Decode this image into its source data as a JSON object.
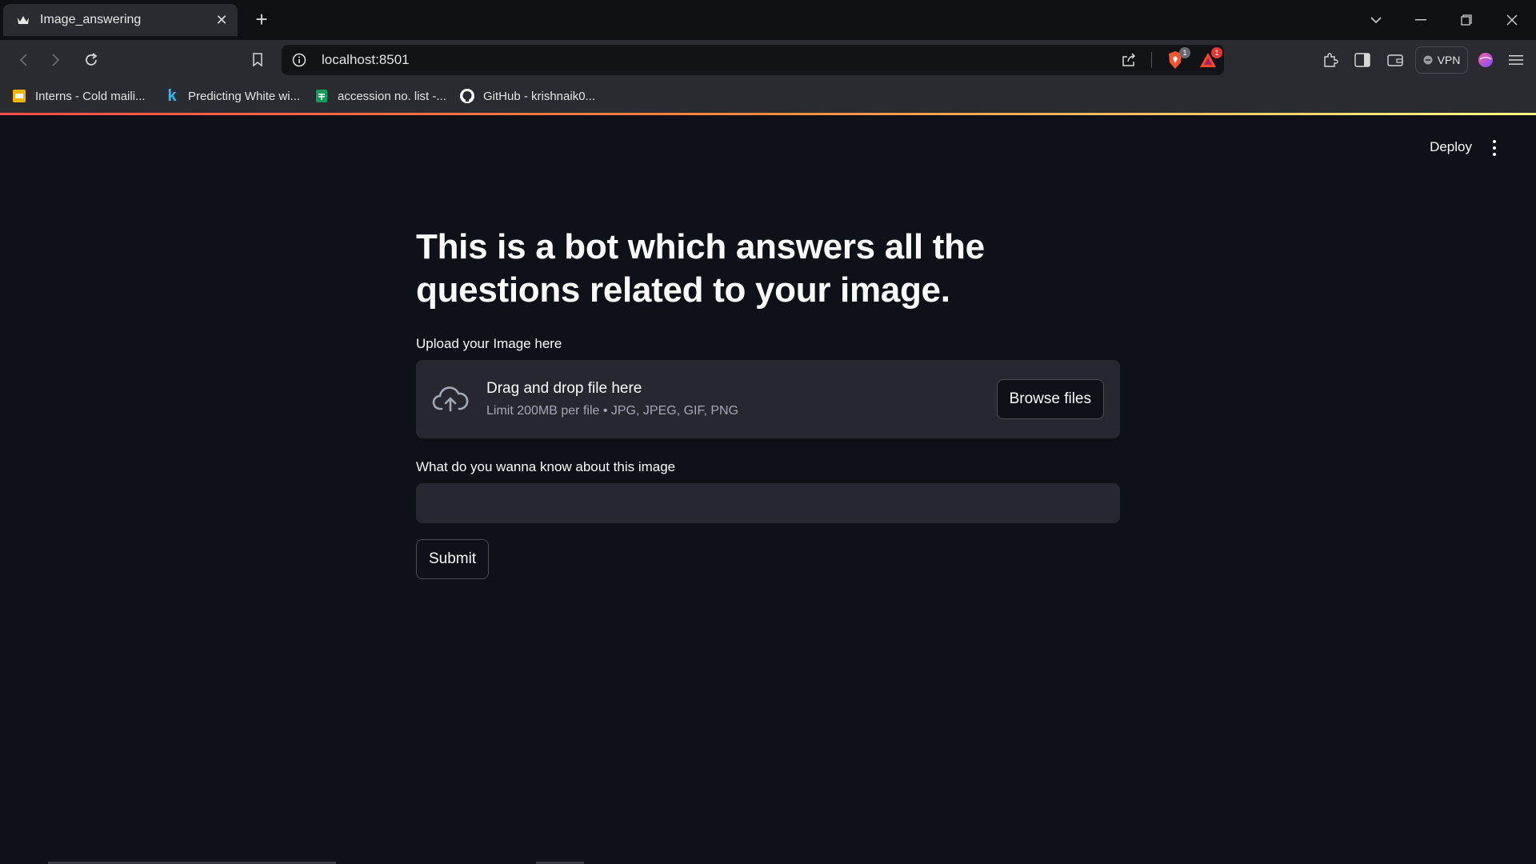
{
  "browser": {
    "tab_title": "Image_answering",
    "url": "localhost:8501",
    "shield_badge": "1",
    "rewards_badge": "1",
    "vpn_label": "VPN",
    "bookmarks": [
      {
        "label": "Interns - Cold maili...",
        "icon": "slides-icon",
        "color": "#f4b400"
      },
      {
        "label": "Predicting White wi...",
        "icon": "kaggle-icon",
        "color": "#20beff"
      },
      {
        "label": "accession no. list -...",
        "icon": "sheets-icon",
        "color": "#0f9d58"
      },
      {
        "label": "GitHub - krishnaik0...",
        "icon": "github-icon",
        "color": "#ffffff"
      }
    ]
  },
  "app": {
    "deploy_label": "Deploy",
    "title": "This is a bot which answers all the questions related to your image.",
    "upload_label": "Upload your Image here",
    "drag_drop_text": "Drag and drop file here",
    "limit_text": "Limit 200MB per file • JPG, JPEG, GIF, PNG",
    "browse_label": "Browse files",
    "question_label": "What do you wanna know about this image",
    "question_value": "",
    "submit_label": "Submit"
  },
  "colors": {
    "background": "#0e1117",
    "widget_bg": "#262730",
    "accent_start": "#ff4b4b",
    "accent_end": "#fffd80"
  }
}
